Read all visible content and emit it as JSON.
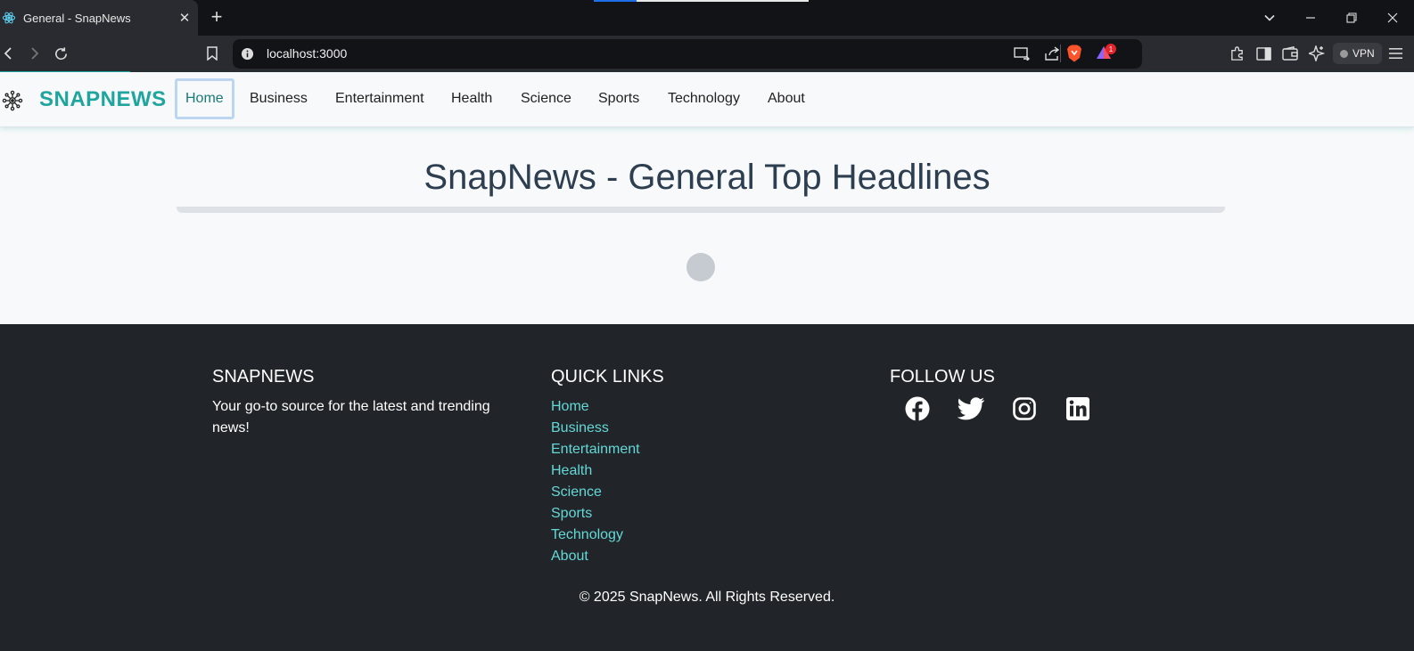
{
  "browser": {
    "tab": {
      "title": "General - SnapNews",
      "favicon": "react-icon"
    },
    "address_bar": {
      "url": "localhost:3000"
    },
    "vpn_label": "VPN",
    "alert_count": "1"
  },
  "navbar": {
    "brand": "SNAPNEWS",
    "items": [
      {
        "label": "Home",
        "active": true
      },
      {
        "label": "Business"
      },
      {
        "label": "Entertainment"
      },
      {
        "label": "Health"
      },
      {
        "label": "Science"
      },
      {
        "label": "Sports"
      },
      {
        "label": "Technology"
      },
      {
        "label": "About"
      }
    ]
  },
  "main": {
    "heading": "SnapNews - General Top Headlines",
    "loading": true
  },
  "footer": {
    "about": {
      "title": "SNAPNEWS",
      "text": "Your go-to source for the latest and trending news!"
    },
    "quick_links": {
      "title": "QUICK LINKS",
      "links": [
        "Home",
        "Business",
        "Entertainment",
        "Health",
        "Science",
        "Sports",
        "Technology",
        "About"
      ]
    },
    "follow": {
      "title": "FOLLOW US",
      "icons": [
        "facebook-icon",
        "twitter-icon",
        "instagram-icon",
        "linkedin-icon"
      ]
    },
    "copyright": "© 2025 SnapNews. All Rights Reserved."
  },
  "colors": {
    "brand": "#1fa59e",
    "footer_bg": "#212529",
    "footer_link": "#64d8d6",
    "heading": "#2c3e50"
  }
}
